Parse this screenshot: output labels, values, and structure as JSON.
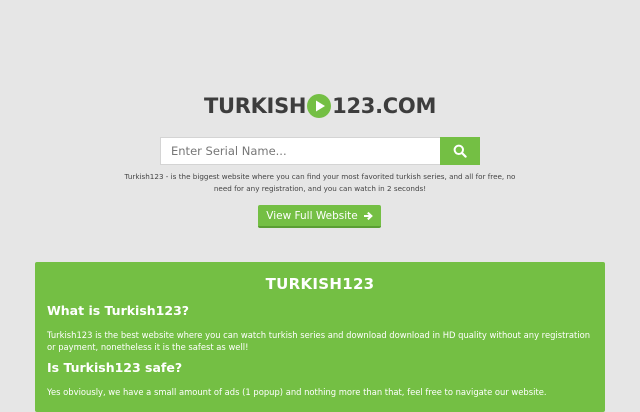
{
  "logo": {
    "left_text": "TURKISH",
    "right_text": "123.COM"
  },
  "search": {
    "placeholder": "Enter Serial Name...",
    "value": ""
  },
  "tagline": "Turkish123 - is the biggest website where you can find your most favorited turkish series, and all for free, no need for any registration, and you can watch in 2 seconds!",
  "cta": {
    "label": "View Full Website"
  },
  "info": {
    "title": "TURKISH123",
    "q1": "What is Turkish123?",
    "a1": "Turkish123 is the best website where you can watch turkish series and download download in HD quality without any registration or payment, nonetheless it is the safest as well!",
    "q2": "Is Turkish123 safe?",
    "a2": "Yes obviously, we have a small amount of ads (1 popup) and nothing more than that, feel free to navigate our website."
  },
  "colors": {
    "accent": "#74bf44",
    "background": "#e6e6e6",
    "logo_text": "#3d3d3d"
  },
  "icons": {
    "logo": "play-circle-icon",
    "search": "search-icon",
    "cta": "arrow-right-icon"
  }
}
